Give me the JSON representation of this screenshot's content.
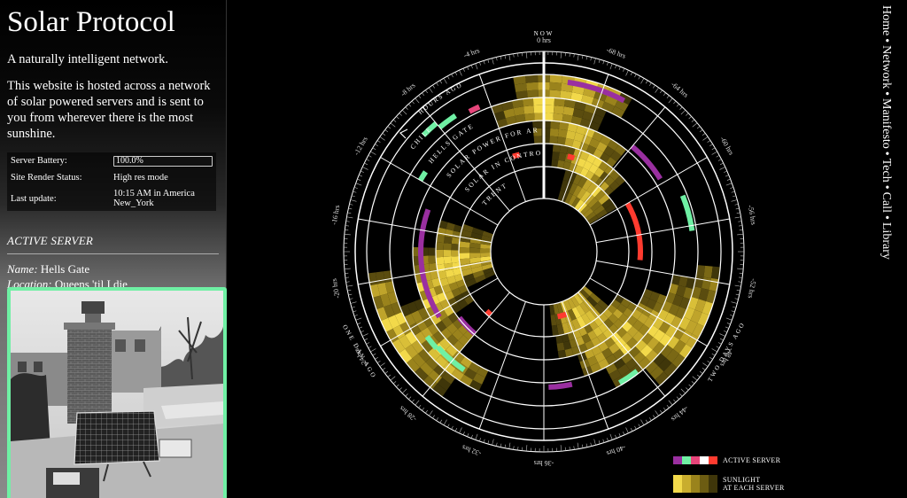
{
  "site": {
    "title": "Solar Protocol",
    "tagline": "A naturally intelligent network.",
    "description": "This website is hosted across a network of solar powered servers and is sent to you from wherever there is the most sunshine."
  },
  "status": {
    "battery_label": "Server Battery:",
    "battery_value": "100.0%",
    "battery_level": 1.0,
    "render_label": "Site Render Status:",
    "render_value": "High res mode",
    "update_label": "Last update:",
    "update_value": "10:15 AM in America New_York"
  },
  "active_server": {
    "heading": "ACTIVE SERVER",
    "name_label": "Name:",
    "name_value": "Hells Gate",
    "location_label": "Location:",
    "location_value": "Queens 'til I die",
    "photo_icon": "rooftop-solar-panel-photo"
  },
  "nav": {
    "items": [
      "Home",
      "Network",
      "Manifesto",
      "Tech",
      "Call",
      "Library"
    ],
    "separator": "•"
  },
  "viz": {
    "now_label": "NOW",
    "hours_ago_label": "HOURS AGO",
    "one_day_ago_label": "ONE DAY AGO",
    "two_days_ago_label": "TWO DAYS AGO",
    "hour_labels": [
      "0 hrs",
      "-4 hrs",
      "-8 hrs",
      "-12 hrs",
      "-16 hrs",
      "-20 hrs",
      "-24 hrs",
      "-28 hrs",
      "-32 hrs",
      "-36 hrs",
      "-40 hrs",
      "-44 hrs",
      "-48 hrs",
      "-52 hrs",
      "-56 hrs",
      "-60 hrs",
      "-64 hrs",
      "-68 hrs"
    ],
    "server_names": [
      "CHILE",
      "HELLS GATE",
      "SOLAR POWER FOR ARTISTS",
      "SOLAR IN CONTROL",
      "TRENT"
    ],
    "colors": {
      "sun_bright": "#f2d94a",
      "sun_mid": "#a89020",
      "sun_dark": "#4a400c",
      "active_green": "#6ff0a4",
      "active_purple": "#9a2fa0",
      "active_red": "#ff3b2f",
      "active_pink": "#e6457a",
      "ring": "#ffffff"
    }
  },
  "legend": {
    "active_server_label": "ACTIVE SERVER",
    "sunlight_line1": "SUNLIGHT",
    "sunlight_line2": "AT EACH SERVER"
  }
}
